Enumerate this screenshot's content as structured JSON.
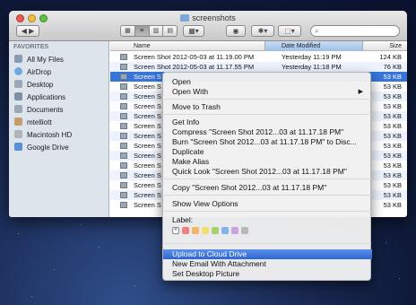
{
  "window": {
    "title": "screenshots",
    "nav_label": "◀ ▶",
    "view_icons": [
      "▦",
      "≡",
      "▥",
      "▤"
    ],
    "arrange_label": "▦▾",
    "eye_label": "◉",
    "gear_label": "✱▾",
    "share_label": "⬚▾",
    "search_placeholder": ""
  },
  "sidebar": {
    "header": "FAVORITES",
    "items": [
      {
        "label": "All My Files",
        "color": "#8c9bb0"
      },
      {
        "label": "AirDrop",
        "color": "#6fa7e0"
      },
      {
        "label": "Desktop",
        "color": "#9aa7b5"
      },
      {
        "label": "Applications",
        "color": "#7e8fa6"
      },
      {
        "label": "Documents",
        "color": "#9aa7b5"
      },
      {
        "label": "mtelliott",
        "color": "#c69c6d"
      },
      {
        "label": "Macintosh HD",
        "color": "#b0b4ba"
      },
      {
        "label": "Google Drive",
        "color": "#5c8fd6"
      }
    ]
  },
  "list": {
    "columns": {
      "name": "Name",
      "date": "Date Modified",
      "size": "Size"
    },
    "rows": [
      {
        "name": "Screen Shot 2012-05-03 at 11.19.00 PM",
        "date": "Yesterday 11:19 PM",
        "size": "124 KB"
      },
      {
        "name": "Screen Shot 2012-05-03 at 11.17.55 PM",
        "date": "Yesterday 11:18 PM",
        "size": "76 KB"
      },
      {
        "name": "Screen S",
        "date": "",
        "size": "53 KB"
      },
      {
        "name": "Screen S",
        "date": "",
        "size": "53 KB"
      },
      {
        "name": "Screen S",
        "date": "",
        "size": "53 KB"
      },
      {
        "name": "Screen S",
        "date": "",
        "size": "53 KB"
      },
      {
        "name": "Screen S",
        "date": "",
        "size": "53 KB"
      },
      {
        "name": "Screen S",
        "date": "",
        "size": "53 KB"
      },
      {
        "name": "Screen S",
        "date": "",
        "size": "53 KB"
      },
      {
        "name": "Screen S",
        "date": "",
        "size": "53 KB"
      },
      {
        "name": "Screen S",
        "date": "",
        "size": "53 KB"
      },
      {
        "name": "Screen S",
        "date": "",
        "size": "53 KB"
      },
      {
        "name": "Screen S",
        "date": "",
        "size": "53 KB"
      },
      {
        "name": "Screen S",
        "date": "",
        "size": "53 KB"
      },
      {
        "name": "Screen S",
        "date": "",
        "size": "53 KB"
      },
      {
        "name": "Screen S",
        "date": "",
        "size": "53 KB"
      }
    ]
  },
  "context_menu": {
    "open": "Open",
    "open_with": "Open With",
    "move_to_trash": "Move to Trash",
    "get_info": "Get Info",
    "compress": "Compress \"Screen Shot 2012...03 at 11.17.18 PM\"",
    "burn": "Burn \"Screen Shot 2012...03 at 11.17.18 PM\" to Disc...",
    "duplicate": "Duplicate",
    "make_alias": "Make Alias",
    "quick_look": "Quick Look \"Screen Shot 2012...03 at 11.17.18 PM\"",
    "copy": "Copy \"Screen Shot 2012...03 at 11.17.18 PM\"",
    "show_view_options": "Show View Options",
    "label_header": "Label:",
    "label_colors": [
      "#f08080",
      "#f4b46a",
      "#f2de6b",
      "#a8d26b",
      "#7fb3ea",
      "#c9a3e0",
      "#b9b9b9"
    ],
    "upload": "Upload to Cloud Drive",
    "new_email": "New Email With Attachment",
    "set_desktop": "Set Desktop Picture"
  },
  "colors": {
    "selection": "#3875d7",
    "highlight": "#2f66d0"
  }
}
